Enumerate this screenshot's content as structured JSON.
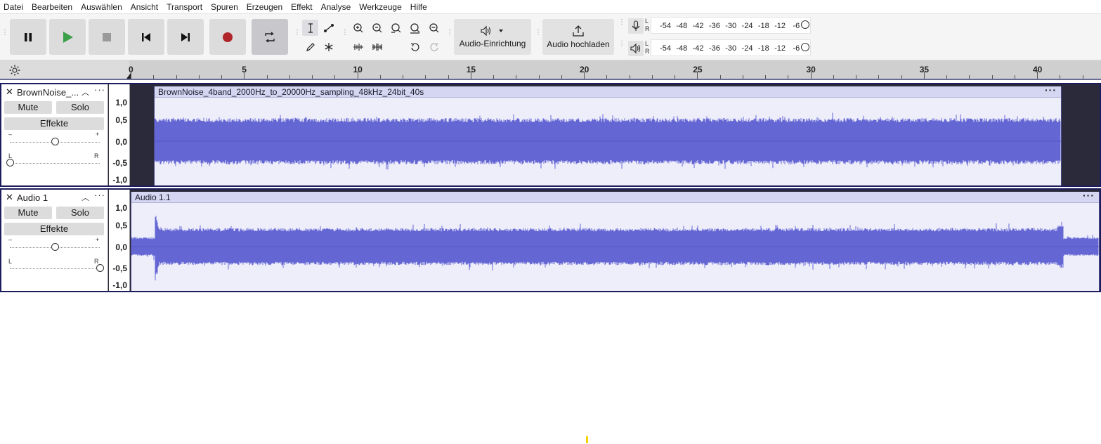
{
  "menu": [
    "Datei",
    "Bearbeiten",
    "Auswählen",
    "Ansicht",
    "Transport",
    "Spuren",
    "Erzeugen",
    "Effekt",
    "Analyse",
    "Werkzeuge",
    "Hilfe"
  ],
  "toolbar": {
    "audio_setup_label": "Audio-Einrichtung",
    "upload_label": "Audio hochladen"
  },
  "meters": {
    "record_lr": [
      "L",
      "R"
    ],
    "playback_lr": [
      "L",
      "R"
    ],
    "ticks": [
      "-54",
      "-48",
      "-42",
      "-36",
      "-30",
      "-24",
      "-18",
      "-12",
      "-6"
    ]
  },
  "ruler": {
    "labels": [
      "0",
      "5",
      "10",
      "15",
      "20",
      "25",
      "30",
      "35",
      "40"
    ]
  },
  "tracks": [
    {
      "name": "BrownNoise_...",
      "mute_label": "Mute",
      "solo_label": "Solo",
      "effects_label": "Effekte",
      "gain_minus": "–",
      "gain_plus": "+",
      "pan_left": "L",
      "pan_right": "R",
      "gain": 0.5,
      "pan": 0.0,
      "scale": [
        "1,0",
        "0,5",
        "0,0",
        "-0,5",
        "-1,0"
      ],
      "clip_title": "BrownNoise_4band_2000Hz_to_20000Hz_sampling_48kHz_24bit_40s"
    },
    {
      "name": "Audio 1",
      "mute_label": "Mute",
      "solo_label": "Solo",
      "effects_label": "Effekte",
      "gain_minus": "–",
      "gain_plus": "+",
      "pan_left": "L",
      "pan_right": "R",
      "gain": 0.5,
      "pan": 1.0,
      "scale": [
        "1,0",
        "0,5",
        "0,0",
        "-0,5",
        "-1,0"
      ],
      "clip_title": "Audio 1.1"
    }
  ],
  "colors": {
    "waveform": "#6466d4",
    "clip_bg": "#eeeefa",
    "clip_header": "#d4d6f2",
    "record": "#b0262a",
    "play": "#3aa04a"
  }
}
